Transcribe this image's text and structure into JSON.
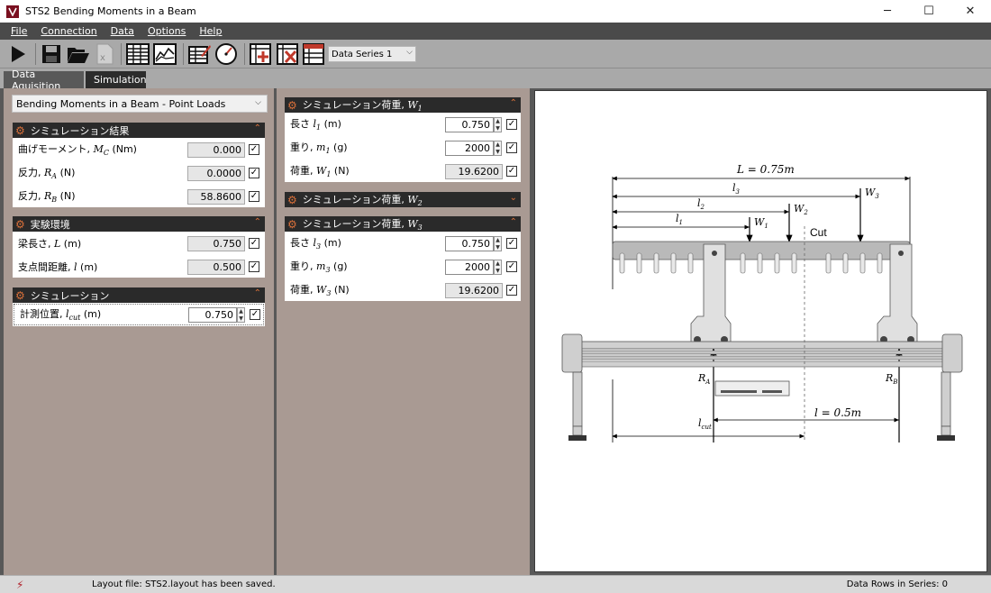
{
  "window": {
    "title": "STS2 Bending Moments in a Beam",
    "minimize": "─",
    "maximize": "☐",
    "close": "✕"
  },
  "menu": [
    "File",
    "Connection",
    "Data",
    "Options",
    "Help"
  ],
  "toolbar": {
    "series_select": "Data Series 1",
    "icons": [
      "play-icon",
      "save-icon",
      "open-folder-icon",
      "export-excel-icon",
      "table-view-icon",
      "chart-view-icon",
      "edit-table-icon",
      "gauge-icon",
      "add-row-icon",
      "delete-row-icon",
      "clear-table-icon"
    ]
  },
  "tabs": [
    "Data Aquisition",
    "Simulation"
  ],
  "left": {
    "preset": "Bending Moments in a Beam - Point Loads",
    "results": {
      "title": "シミュレーション結果",
      "rows": [
        {
          "label": "曲げモーメント, ",
          "sym": "M",
          "sub": "C",
          "unit": " (Nm)",
          "value": "0.000"
        },
        {
          "label": "反力, ",
          "sym": "R",
          "sub": "A",
          "unit": " (N)",
          "value": "0.0000"
        },
        {
          "label": "反力, ",
          "sym": "R",
          "sub": "B",
          "unit": " (N)",
          "value": "58.8600"
        }
      ]
    },
    "env": {
      "title": "実験環境",
      "rows": [
        {
          "label": "梁長さ, ",
          "sym": "L",
          "sub": "",
          "unit": " (m)",
          "value": "0.750"
        },
        {
          "label": "支点間距離, ",
          "sym": "l",
          "sub": "",
          "unit": " (m)",
          "value": "0.500"
        }
      ]
    },
    "sim": {
      "title": "シミュレーション",
      "rows": [
        {
          "label": "計測位置, ",
          "sym": "l",
          "sub": "cut",
          "unit": " (m)",
          "value": "0.750"
        }
      ]
    }
  },
  "middle": {
    "w1": {
      "title": "シミュレーション荷重, ",
      "sym": "W",
      "sub": "1",
      "rows": [
        {
          "label": "長さ ",
          "sym": "l",
          "sub": "1",
          "unit": " (m)",
          "value": "0.750"
        },
        {
          "label": "重り, ",
          "sym": "m",
          "sub": "1",
          "unit": " (g)",
          "value": "2000"
        },
        {
          "label": "荷重, ",
          "sym": "W",
          "sub": "1",
          "unit": " (N)",
          "value": "19.6200"
        }
      ]
    },
    "w2": {
      "title": "シミュレーション荷重, ",
      "sym": "W",
      "sub": "2"
    },
    "w3": {
      "title": "シミュレーション荷重, ",
      "sym": "W",
      "sub": "3",
      "rows": [
        {
          "label": "長さ ",
          "sym": "l",
          "sub": "3",
          "unit": " (m)",
          "value": "0.750"
        },
        {
          "label": "重り, ",
          "sym": "m",
          "sub": "3",
          "unit": " (g)",
          "value": "2000"
        },
        {
          "label": "荷重, ",
          "sym": "W",
          "sub": "3",
          "unit": " (N)",
          "value": "19.6200"
        }
      ]
    }
  },
  "diagram": {
    "L": "L = 0.75m",
    "l3": "l",
    "l3sub": "3",
    "l2": "l",
    "l2sub": "2",
    "l1": "l",
    "l1sub": "1",
    "W1": "W",
    "W1sub": "1",
    "W2": "W",
    "W2sub": "2",
    "W3": "W",
    "W3sub": "3",
    "cut": "Cut",
    "RA": "R",
    "RAsub": "A",
    "RB": "R",
    "RBsub": "B",
    "lcut": "l",
    "lcutsub": "cut",
    "lspan": "l = 0.5m"
  },
  "status": {
    "message": "Layout file: STS2.layout has been saved.",
    "rows": "Data Rows in Series: 0"
  }
}
